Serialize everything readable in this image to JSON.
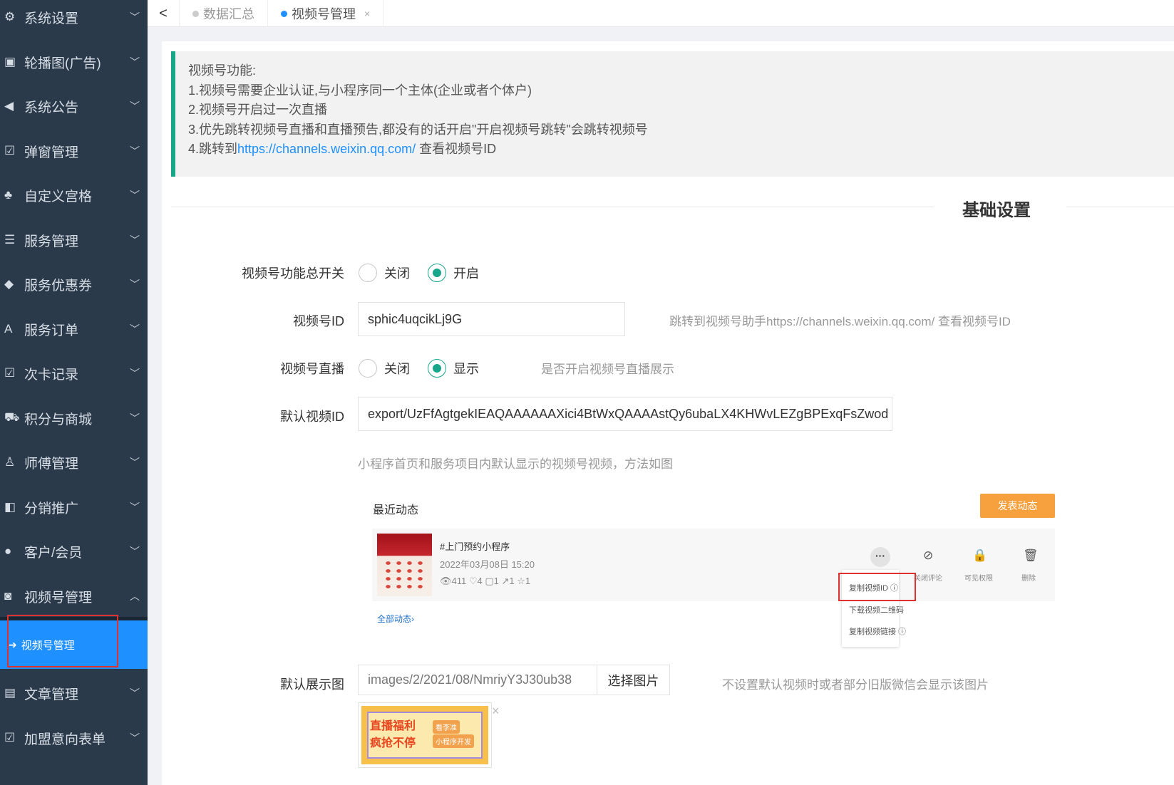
{
  "sidebar": {
    "items": [
      {
        "label": "系统设置",
        "icon": "gear-icon",
        "glyph": "⚙",
        "chev": "﹀"
      },
      {
        "label": "轮播图(广告)",
        "icon": "image-icon",
        "glyph": "▣",
        "chev": "﹀"
      },
      {
        "label": "系统公告",
        "icon": "speaker-icon",
        "glyph": "◀",
        "chev": "﹀"
      },
      {
        "label": "弹窗管理",
        "icon": "check-square-icon",
        "glyph": "☑",
        "chev": "﹀"
      },
      {
        "label": "自定义宫格",
        "icon": "sitemap-icon",
        "glyph": "♣",
        "chev": "﹀"
      },
      {
        "label": "服务管理",
        "icon": "list-icon",
        "glyph": "☰",
        "chev": "﹀"
      },
      {
        "label": "服务优惠券",
        "icon": "tag-icon",
        "glyph": "◆",
        "chev": "﹀"
      },
      {
        "label": "服务订单",
        "icon": "font-icon",
        "glyph": "A",
        "chev": "﹀"
      },
      {
        "label": "次卡记录",
        "icon": "check-square-icon",
        "glyph": "☑",
        "chev": "﹀"
      },
      {
        "label": "积分与商城",
        "icon": "cart-icon",
        "glyph": "⛟",
        "chev": "﹀"
      },
      {
        "label": "师傅管理",
        "icon": "user-tie-icon",
        "glyph": "♙",
        "chev": "﹀"
      },
      {
        "label": "分销推广",
        "icon": "share-icon",
        "glyph": "◧",
        "chev": "﹀"
      },
      {
        "label": "客户/会员",
        "icon": "user-icon",
        "glyph": "●",
        "chev": "﹀"
      },
      {
        "label": "视频号管理",
        "icon": "video-icon",
        "glyph": "◙",
        "chev": "︿"
      },
      {
        "label": "文章管理",
        "icon": "file-icon",
        "glyph": "▤",
        "chev": "﹀"
      },
      {
        "label": "加盟意向表单",
        "icon": "check-square-icon",
        "glyph": "☑",
        "chev": "﹀"
      }
    ],
    "active_sub": {
      "label": "视频号管理",
      "glyph": "➜"
    }
  },
  "tabs": {
    "back": "<",
    "items": [
      {
        "label": "数据汇总"
      },
      {
        "label": "视频号管理",
        "close": "×"
      }
    ]
  },
  "notice": {
    "title": "视频号功能:",
    "line1": "1.视频号需要企业认证,与小程序同一个主体(企业或者个体户)",
    "line2": "2.视频号开启过一次直播",
    "line3": "3.优先跳转视频号直播和直播预告,都没有的话开启\"开启视频号跳转\"会跳转视频号",
    "line4_prefix": "4.跳转到",
    "line4_link": "https://channels.weixin.qq.com/",
    "line4_suffix": " 查看视频号ID"
  },
  "section": {
    "title": "基础设置"
  },
  "form": {
    "switch": {
      "label": "视频号功能总开关",
      "off": "关闭",
      "on": "开启",
      "selected": "开启"
    },
    "video_id": {
      "label": "视频号ID",
      "value": "sphic4uqcikLj9G",
      "hint": "跳转到视频号助手https://channels.weixin.qq.com/ 查看视频号ID"
    },
    "live": {
      "label": "视频号直播",
      "off": "关闭",
      "on": "显示",
      "selected": "显示",
      "hint": "是否开启视频号直播展示"
    },
    "default_video": {
      "label": "默认视频ID",
      "value": "export/UzFfAgtgekIEAQAAAAAAXici4BtWxQAAAAstQy6ubaLX4KHWvLEZgBPExqFsZwod",
      "hint": "小程序首页和服务项目内默认显示的视频号视频，方法如图"
    },
    "default_image": {
      "label": "默认展示图",
      "value": "images/2/2021/08/NmriyY3J30ub38",
      "button": "选择图片",
      "hint": "不设置默认视频时或者部分旧版微信会显示该图片",
      "remove": "×"
    }
  },
  "illustration": {
    "title": "最近动态",
    "publish": "发表动态",
    "post_title": "#上门预约小程序",
    "post_date": "2022年03月08日 15:20",
    "stats": "👁411  ♡4  ▢1  ↗1  ☆1",
    "more": "···",
    "actions": [
      {
        "glyph": "⊘",
        "caption": "关闭评论"
      },
      {
        "glyph": "🔒",
        "caption": "可见权限"
      },
      {
        "glyph": "🗑",
        "caption": "删除"
      }
    ],
    "menu": [
      "复制视频ID ⓘ",
      "下载视频二维码",
      "复制视频链接 ⓘ"
    ],
    "all_posts": "全部动态›"
  },
  "preview_image": {
    "line1": "直播福利",
    "line2": "疯抢不停",
    "tag1": "看李准",
    "tag2": "小程序开发"
  },
  "colors": {
    "sidebar_bg": "#2b3a4a",
    "active_blue": "#1e90ff",
    "accent_green": "#17a689",
    "orange": "#f7a13e",
    "highlight_red": "#e03030"
  }
}
